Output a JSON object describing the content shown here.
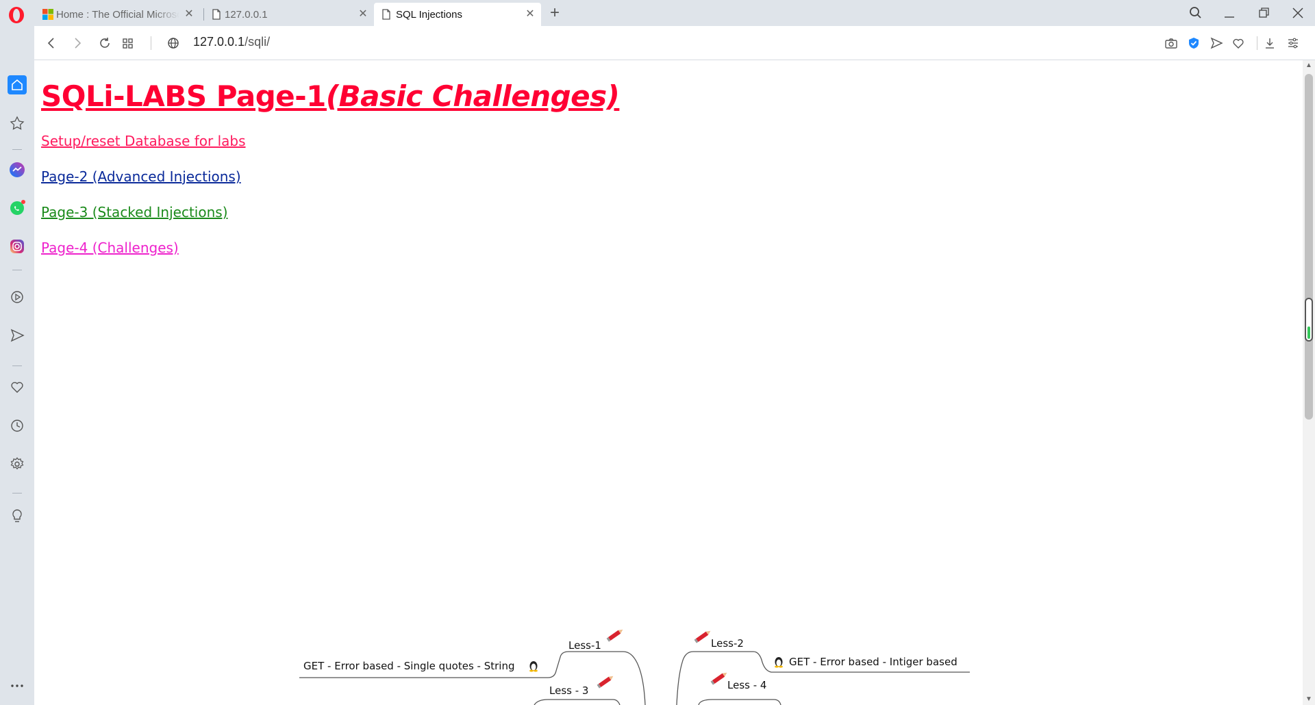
{
  "browser": {
    "tabs": [
      {
        "title": "Home : The Official Microsoft Site",
        "active": false
      },
      {
        "title": "127.0.0.1",
        "active": false
      },
      {
        "title": "SQL Injections",
        "active": true
      }
    ],
    "url_host": "127.0.0.1",
    "url_path": "/sqli/",
    "accent": "#1e88ff"
  },
  "page": {
    "title_main": "SQLi-LABS Page-1",
    "title_sub": "(Basic Challenges)",
    "links": [
      {
        "label": "Setup/reset Database for labs",
        "color": "#ff1a5e"
      },
      {
        "label": "Page-2 (Advanced Injections)",
        "color": "#0a2a9a"
      },
      {
        "label": "Page-3 (Stacked Injections)",
        "color": "#1a8a1a"
      },
      {
        "label": "Page-4 (Challenges)",
        "color": "#ee22cc"
      }
    ]
  },
  "mindmap": {
    "nodes": [
      {
        "label": "Less-1"
      },
      {
        "label": "GET - Error based - Single quotes - String"
      },
      {
        "label": "Less - 3"
      },
      {
        "label": "Less-2"
      },
      {
        "label": "GET - Error based - Intiger based"
      },
      {
        "label": "Less - 4"
      }
    ]
  },
  "sidebar": {
    "items": [
      "home-icon",
      "bookmarks-icon",
      "messenger-icon",
      "whatsapp-icon",
      "instagram-icon",
      "player-icon",
      "send-icon",
      "heart-icon",
      "history-icon",
      "settings-icon",
      "tips-icon",
      "more-icon"
    ]
  }
}
